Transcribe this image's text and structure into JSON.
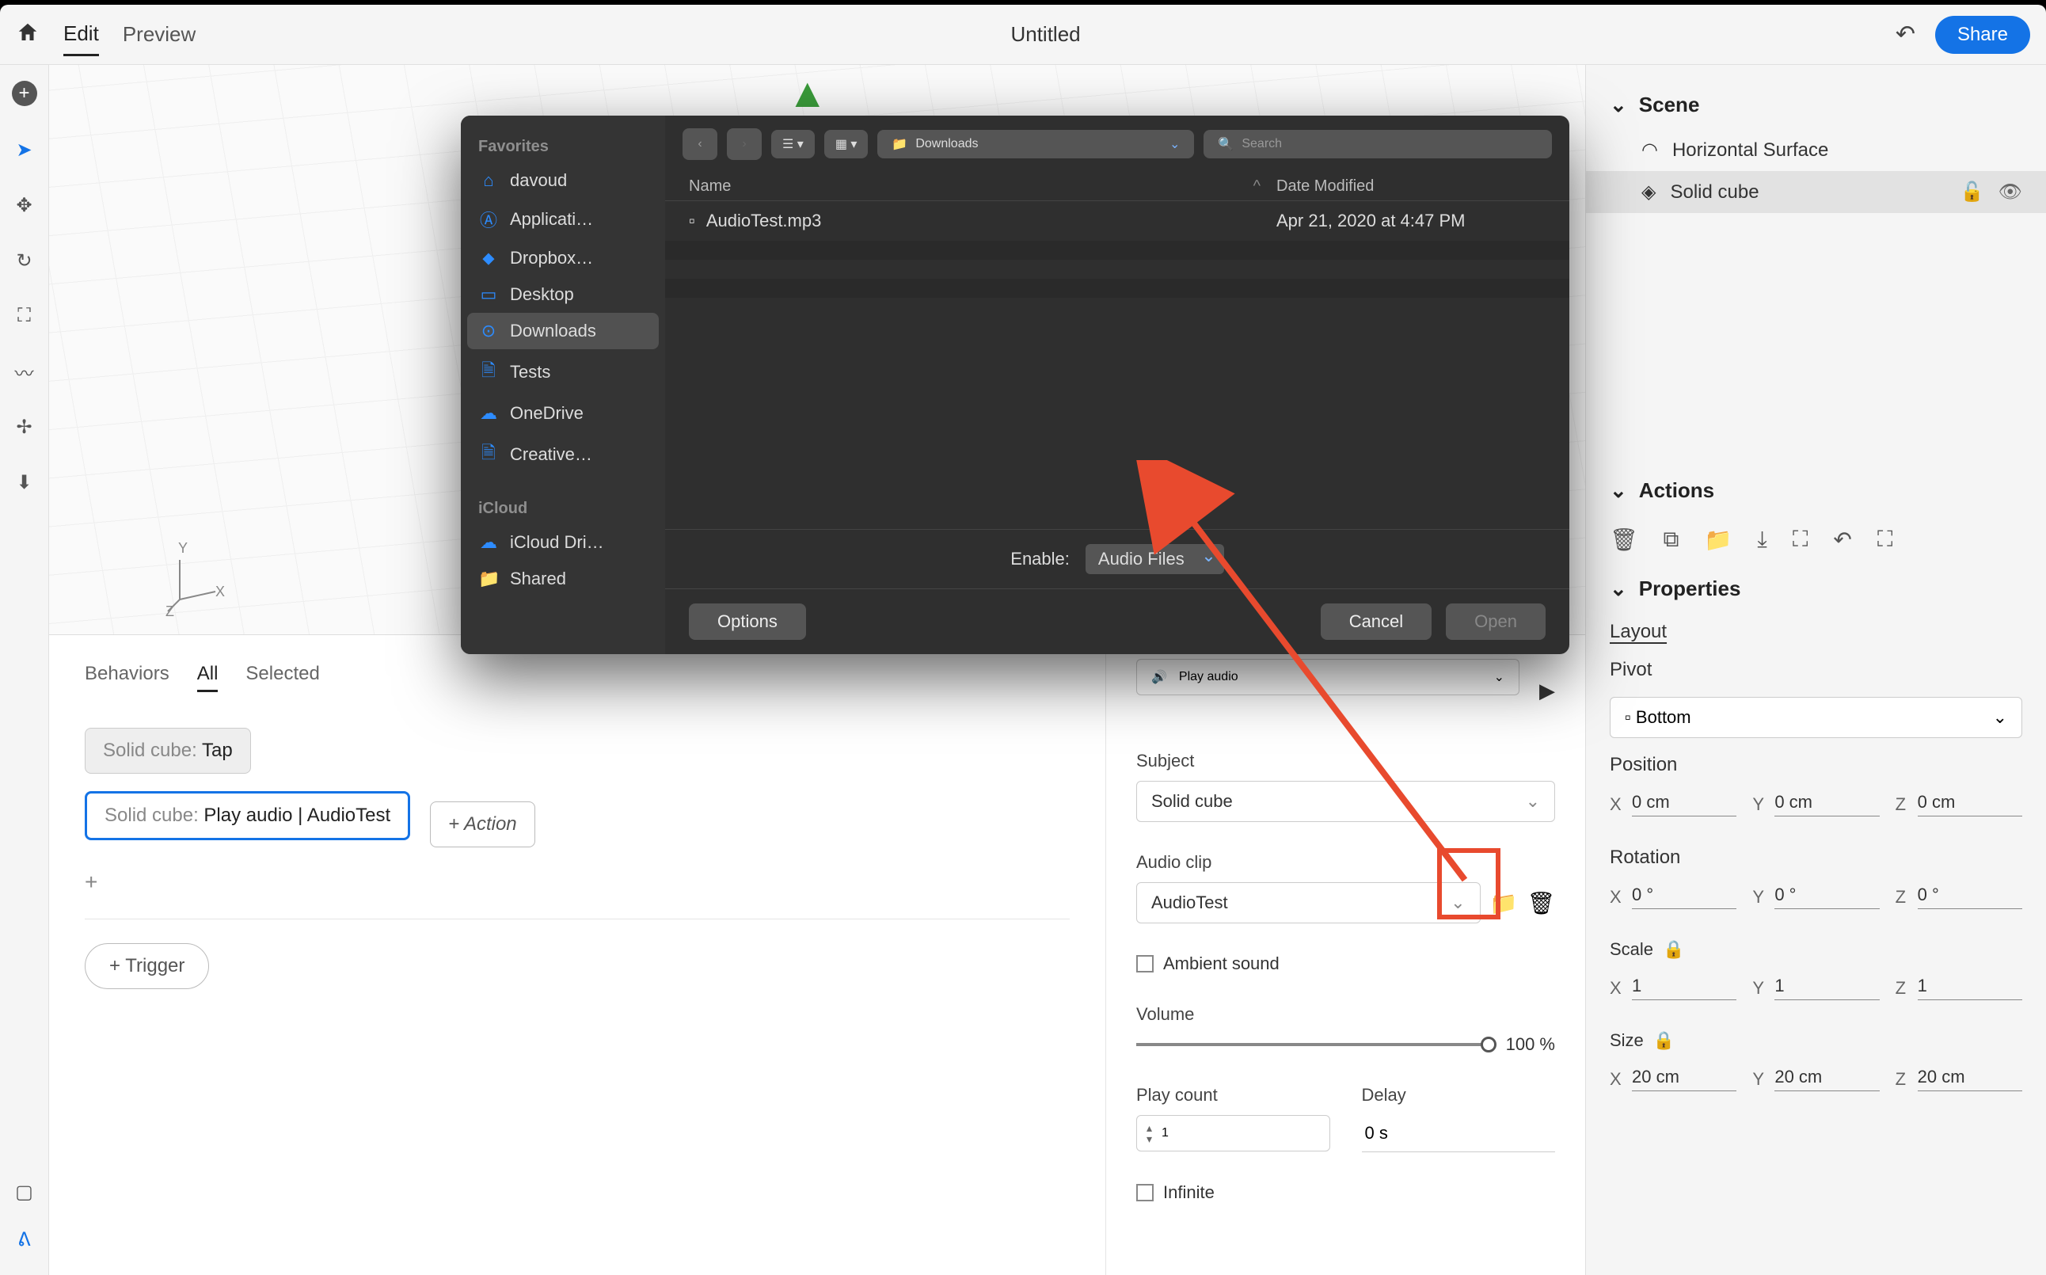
{
  "topbar": {
    "edit": "Edit",
    "preview": "Preview",
    "title": "Untitled",
    "share": "Share"
  },
  "scenePanel": {
    "header": "Scene",
    "items": [
      {
        "label": "Horizontal Surface"
      },
      {
        "label": "Solid cube"
      }
    ],
    "actionsHeader": "Actions",
    "propertiesHeader": "Properties",
    "layoutLabel": "Layout",
    "pivotLabel": "Pivot",
    "pivotValue": "Bottom",
    "positionLabel": "Position",
    "position": {
      "x": "0 cm",
      "y": "0 cm",
      "z": "0 cm"
    },
    "rotationLabel": "Rotation",
    "rotation": {
      "x": "0 °",
      "y": "0 °",
      "z": "0 °"
    },
    "scaleLabel": "Scale",
    "scale": {
      "x": "1",
      "y": "1",
      "z": "1"
    },
    "sizeLabel": "Size",
    "size": {
      "x": "20 cm",
      "y": "20 cm",
      "z": "20 cm"
    }
  },
  "behaviors": {
    "tabs": {
      "label": "Behaviors",
      "all": "All",
      "selected": "Selected"
    },
    "chipTap": {
      "obj": "Solid cube:",
      "act": "Tap"
    },
    "chipPlay": {
      "obj": "Solid cube:",
      "act": "Play audio | AudioTest"
    },
    "addAction": "+ Action",
    "triggerBtn": "+ Trigger"
  },
  "actionDetail": {
    "dropdown": "Play audio",
    "subjectLabel": "Subject",
    "subjectValue": "Solid cube",
    "audioClipLabel": "Audio clip",
    "audioClipValue": "AudioTest",
    "ambient": "Ambient sound",
    "volumeLabel": "Volume",
    "volumeValue": "100 %",
    "playCountLabel": "Play count",
    "playCountValue": "1",
    "delayLabel": "Delay",
    "delayValue": "0 s",
    "infinite": "Infinite"
  },
  "fileDialog": {
    "favoritesHeader": "Favorites",
    "iCloudHeader": "iCloud",
    "sidebar": [
      {
        "icon": "home",
        "label": "davoud"
      },
      {
        "icon": "app",
        "label": "Applicati…"
      },
      {
        "icon": "dropbox",
        "label": "Dropbox…"
      },
      {
        "icon": "desktop",
        "label": "Desktop"
      },
      {
        "icon": "download",
        "label": "Downloads",
        "selected": true
      },
      {
        "icon": "doc",
        "label": "Tests"
      },
      {
        "icon": "cloud",
        "label": "OneDrive"
      },
      {
        "icon": "doc",
        "label": "Creative…"
      }
    ],
    "iCloudItems": [
      {
        "icon": "cloud",
        "label": "iCloud Dri…"
      },
      {
        "icon": "folder",
        "label": "Shared"
      }
    ],
    "pathLabel": "Downloads",
    "searchPlaceholder": "Search",
    "colName": "Name",
    "colDate": "Date Modified",
    "files": [
      {
        "name": "AudioTest.mp3",
        "date": "Apr 21, 2020 at 4:47 PM"
      }
    ],
    "enableLabel": "Enable:",
    "enableValue": "Audio Files",
    "optionsBtn": "Options",
    "cancelBtn": "Cancel",
    "openBtn": "Open"
  }
}
